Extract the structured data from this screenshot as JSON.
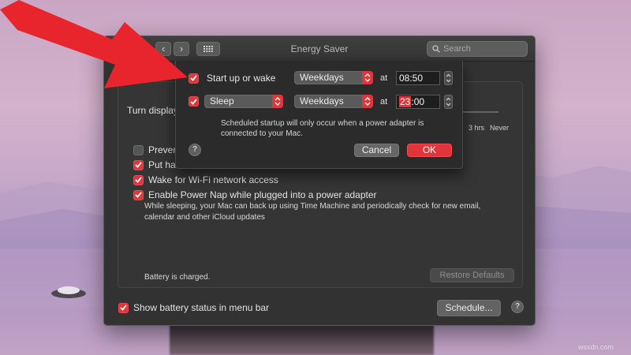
{
  "window": {
    "title": "Energy Saver",
    "search_placeholder": "Search",
    "nav_back": "‹",
    "nav_forward": "›"
  },
  "panel": {
    "turn_display_label": "Turn display",
    "ticks": [
      "3 hrs",
      "Never"
    ],
    "options": [
      {
        "label": "Prevent",
        "checked": false
      },
      {
        "label": "Put harc",
        "checked": true
      },
      {
        "label": "Wake for Wi-Fi network access",
        "checked": true
      },
      {
        "label": "Enable Power Nap while plugged into a power adapter",
        "checked": true
      }
    ],
    "power_nap_description": "While sleeping, your Mac can back up using Time Machine and periodically check for new email, calendar and other iCloud updates",
    "battery_status": "Battery is charged.",
    "restore_defaults": "Restore Defaults",
    "show_battery_label": "Show battery status in menu bar",
    "show_battery_checked": true,
    "schedule_button": "Schedule...",
    "help": "?"
  },
  "sheet": {
    "row1": {
      "label": "Start up or wake",
      "checked": true,
      "days": "Weekdays",
      "at": "at",
      "time": "08:50"
    },
    "row2": {
      "action": "Sleep",
      "checked": true,
      "days": "Weekdays",
      "at": "at",
      "time_hour": "23",
      "time_rest": ":00"
    },
    "note": "Scheduled startup will only occur when a power adapter is connected to your Mac.",
    "help": "?",
    "cancel": "Cancel",
    "ok": "OK"
  },
  "watermark": "wsxdn.com",
  "colors": {
    "accent": "#e0353b",
    "arrow": "#e8242c",
    "window_bg": "#323232"
  }
}
